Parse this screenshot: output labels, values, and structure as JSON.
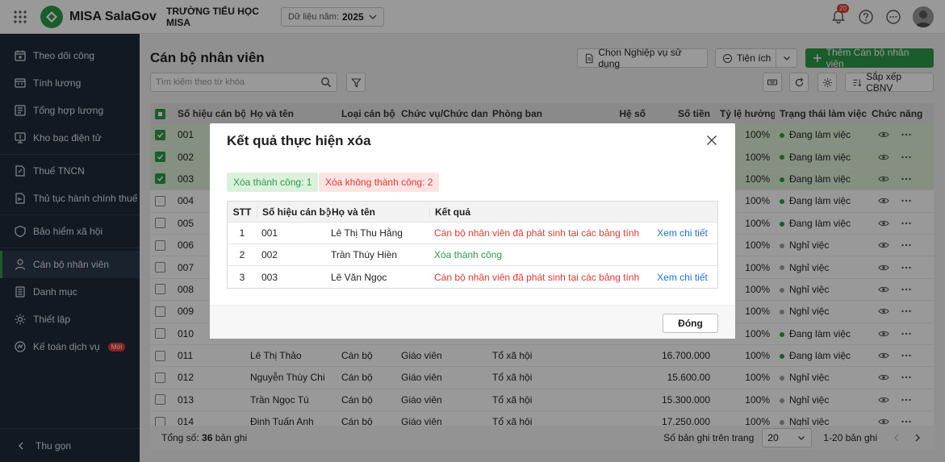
{
  "app": {
    "name": "MISA SalaGov",
    "school": "TRƯỜNG TIỂU HỌC MISA",
    "year_label": "Dữ liệu năm:",
    "year_value": "2025",
    "notification_count": "20"
  },
  "sidebar": {
    "items": [
      {
        "label": "Theo dõi công",
        "icon": "calendar-icon"
      },
      {
        "label": "Tính lương",
        "icon": "calculator-icon"
      },
      {
        "label": "Tổng hợp lương",
        "icon": "summary-icon"
      },
      {
        "label": "Kho bạc điện tử",
        "icon": "monitor-icon"
      },
      {
        "label": "Thuế TNCN",
        "icon": "tax-doc-icon"
      },
      {
        "label": "Thủ tục hành chính thuế",
        "icon": "procedure-icon"
      },
      {
        "label": "Bảo hiểm xã hội",
        "icon": "shield-icon"
      },
      {
        "label": "Cán bộ nhân viên",
        "icon": "staff-icon"
      },
      {
        "label": "Danh mục",
        "icon": "list-icon"
      },
      {
        "label": "Thiết lập",
        "icon": "gear-icon"
      },
      {
        "label": "Kế toán dịch vụ",
        "icon": "accounting-icon"
      }
    ],
    "new_badge": "Mới",
    "collapse_label": "Thu gọn"
  },
  "page": {
    "title": "Cán bộ nhân viên",
    "choose_button": "Chọn Nghiệp vụ sử dụng",
    "utilities_button": "Tiện ích",
    "add_button": "Thêm Cán bộ nhân viên",
    "search_placeholder": "Tìm kiếm theo từ khóa",
    "sort_button": "Sắp xếp CBNV"
  },
  "table": {
    "headers": {
      "code": "Số hiệu cán bộ",
      "name": "Họ và tên",
      "type": "Loại cán bộ",
      "position": "Chức vụ/Chức danh",
      "dept": "Phòng ban",
      "coef": "Hệ số",
      "amount": "Số tiền",
      "rate": "Tỷ lệ hưởng",
      "status": "Trạng thái làm việc",
      "actions": "Chức năng"
    },
    "rows": [
      {
        "code": "001",
        "name": "",
        "type": "",
        "position": "",
        "dept": "",
        "amount": "",
        "rate": "100%",
        "status": "Đang làm việc",
        "active": true,
        "checked": true
      },
      {
        "code": "002",
        "name": "",
        "type": "",
        "position": "",
        "dept": "",
        "amount": "",
        "rate": "100%",
        "status": "Đang làm việc",
        "active": true,
        "checked": true
      },
      {
        "code": "003",
        "name": "",
        "type": "",
        "position": "",
        "dept": "",
        "amount": "",
        "rate": "100%",
        "status": "Đang làm việc",
        "active": true,
        "checked": true
      },
      {
        "code": "004",
        "name": "",
        "type": "",
        "position": "",
        "dept": "",
        "amount": "",
        "rate": "100%",
        "status": "Đang làm việc",
        "active": true,
        "checked": false
      },
      {
        "code": "005",
        "name": "",
        "type": "",
        "position": "",
        "dept": "",
        "amount": "",
        "rate": "100%",
        "status": "Đang làm việc",
        "active": true,
        "checked": false
      },
      {
        "code": "006",
        "name": "",
        "type": "",
        "position": "",
        "dept": "",
        "amount": "",
        "rate": "100%",
        "status": "Nghỉ việc",
        "active": false,
        "checked": false
      },
      {
        "code": "007",
        "name": "",
        "type": "",
        "position": "",
        "dept": "",
        "amount": "",
        "rate": "100%",
        "status": "Nghỉ việc",
        "active": false,
        "checked": false
      },
      {
        "code": "008",
        "name": "",
        "type": "",
        "position": "",
        "dept": "",
        "amount": "",
        "rate": "100%",
        "status": "Nghỉ việc",
        "active": false,
        "checked": false
      },
      {
        "code": "009",
        "name": "",
        "type": "",
        "position": "",
        "dept": "",
        "amount": "",
        "rate": "100%",
        "status": "Nghỉ việc",
        "active": false,
        "checked": false
      },
      {
        "code": "010",
        "name": "",
        "type": "",
        "position": "",
        "dept": "",
        "amount": "",
        "rate": "100%",
        "status": "Đang làm việc",
        "active": true,
        "checked": false
      },
      {
        "code": "011",
        "name": "Lê Thị Thảo",
        "type": "Cán bộ",
        "position": "Giáo viên",
        "dept": "Tổ xã hội",
        "amount": "16.700.000",
        "rate": "100%",
        "status": "Đang làm việc",
        "active": true,
        "checked": false
      },
      {
        "code": "012",
        "name": "Nguyễn Thùy Chi",
        "type": "Cán bộ",
        "position": "Giáo viên",
        "dept": "Tổ xã hội",
        "amount": "15.600.00",
        "rate": "100%",
        "status": "Nghỉ việc",
        "active": false,
        "checked": false
      },
      {
        "code": "013",
        "name": "Trần Ngọc Tú",
        "type": "Cán bộ",
        "position": "Giáo viên",
        "dept": "Tổ xã hội",
        "amount": "15.300.000",
        "rate": "100%",
        "status": "Nghỉ việc",
        "active": false,
        "checked": false
      },
      {
        "code": "014",
        "name": "Đinh Tuấn Anh",
        "type": "Cán bộ",
        "position": "Giáo viên",
        "dept": "Tổ xã hội",
        "amount": "17.250.000",
        "rate": "100%",
        "status": "Nghỉ việc",
        "active": false,
        "checked": false
      }
    ],
    "total_label": "Tổng số:",
    "total_value": "36",
    "total_unit": "bản ghi",
    "per_page_label": "Số bản ghi trên trang",
    "per_page_value": "20",
    "range_label": "1-20 bản ghi"
  },
  "modal": {
    "title": "Kết quả thực hiện xóa",
    "success_tag": "Xóa thành công: 1",
    "fail_tag": "Xóa không thành công: 2",
    "headers": {
      "stt": "STT",
      "code": "Số hiệu cán bộ",
      "name": "Họ và tên",
      "result": "Kết quả"
    },
    "rows": [
      {
        "stt": "1",
        "code": "001",
        "name": "Lê Thị Thu Hằng",
        "result": "Cán bộ nhân viên đã phát sinh tại các bảng tính",
        "ok": false,
        "link": "Xem chi tiết"
      },
      {
        "stt": "2",
        "code": "002",
        "name": "Trần Thúy Hiền",
        "result": "Xóa thành công",
        "ok": true,
        "link": ""
      },
      {
        "stt": "3",
        "code": "003",
        "name": "Lê Văn Ngọc",
        "result": "Cán bộ nhân viên đã phát sinh tại các bảng tính",
        "ok": false,
        "link": "Xem chi tiết"
      }
    ],
    "close_button": "Đóng"
  },
  "colors": {
    "brand": "#2e9a4b",
    "sidebar": "#1e2a3b",
    "error": "#e53935",
    "success": "#2e9a4b",
    "link": "#1a73e8",
    "inactive_dot": "#9e9e9e"
  }
}
